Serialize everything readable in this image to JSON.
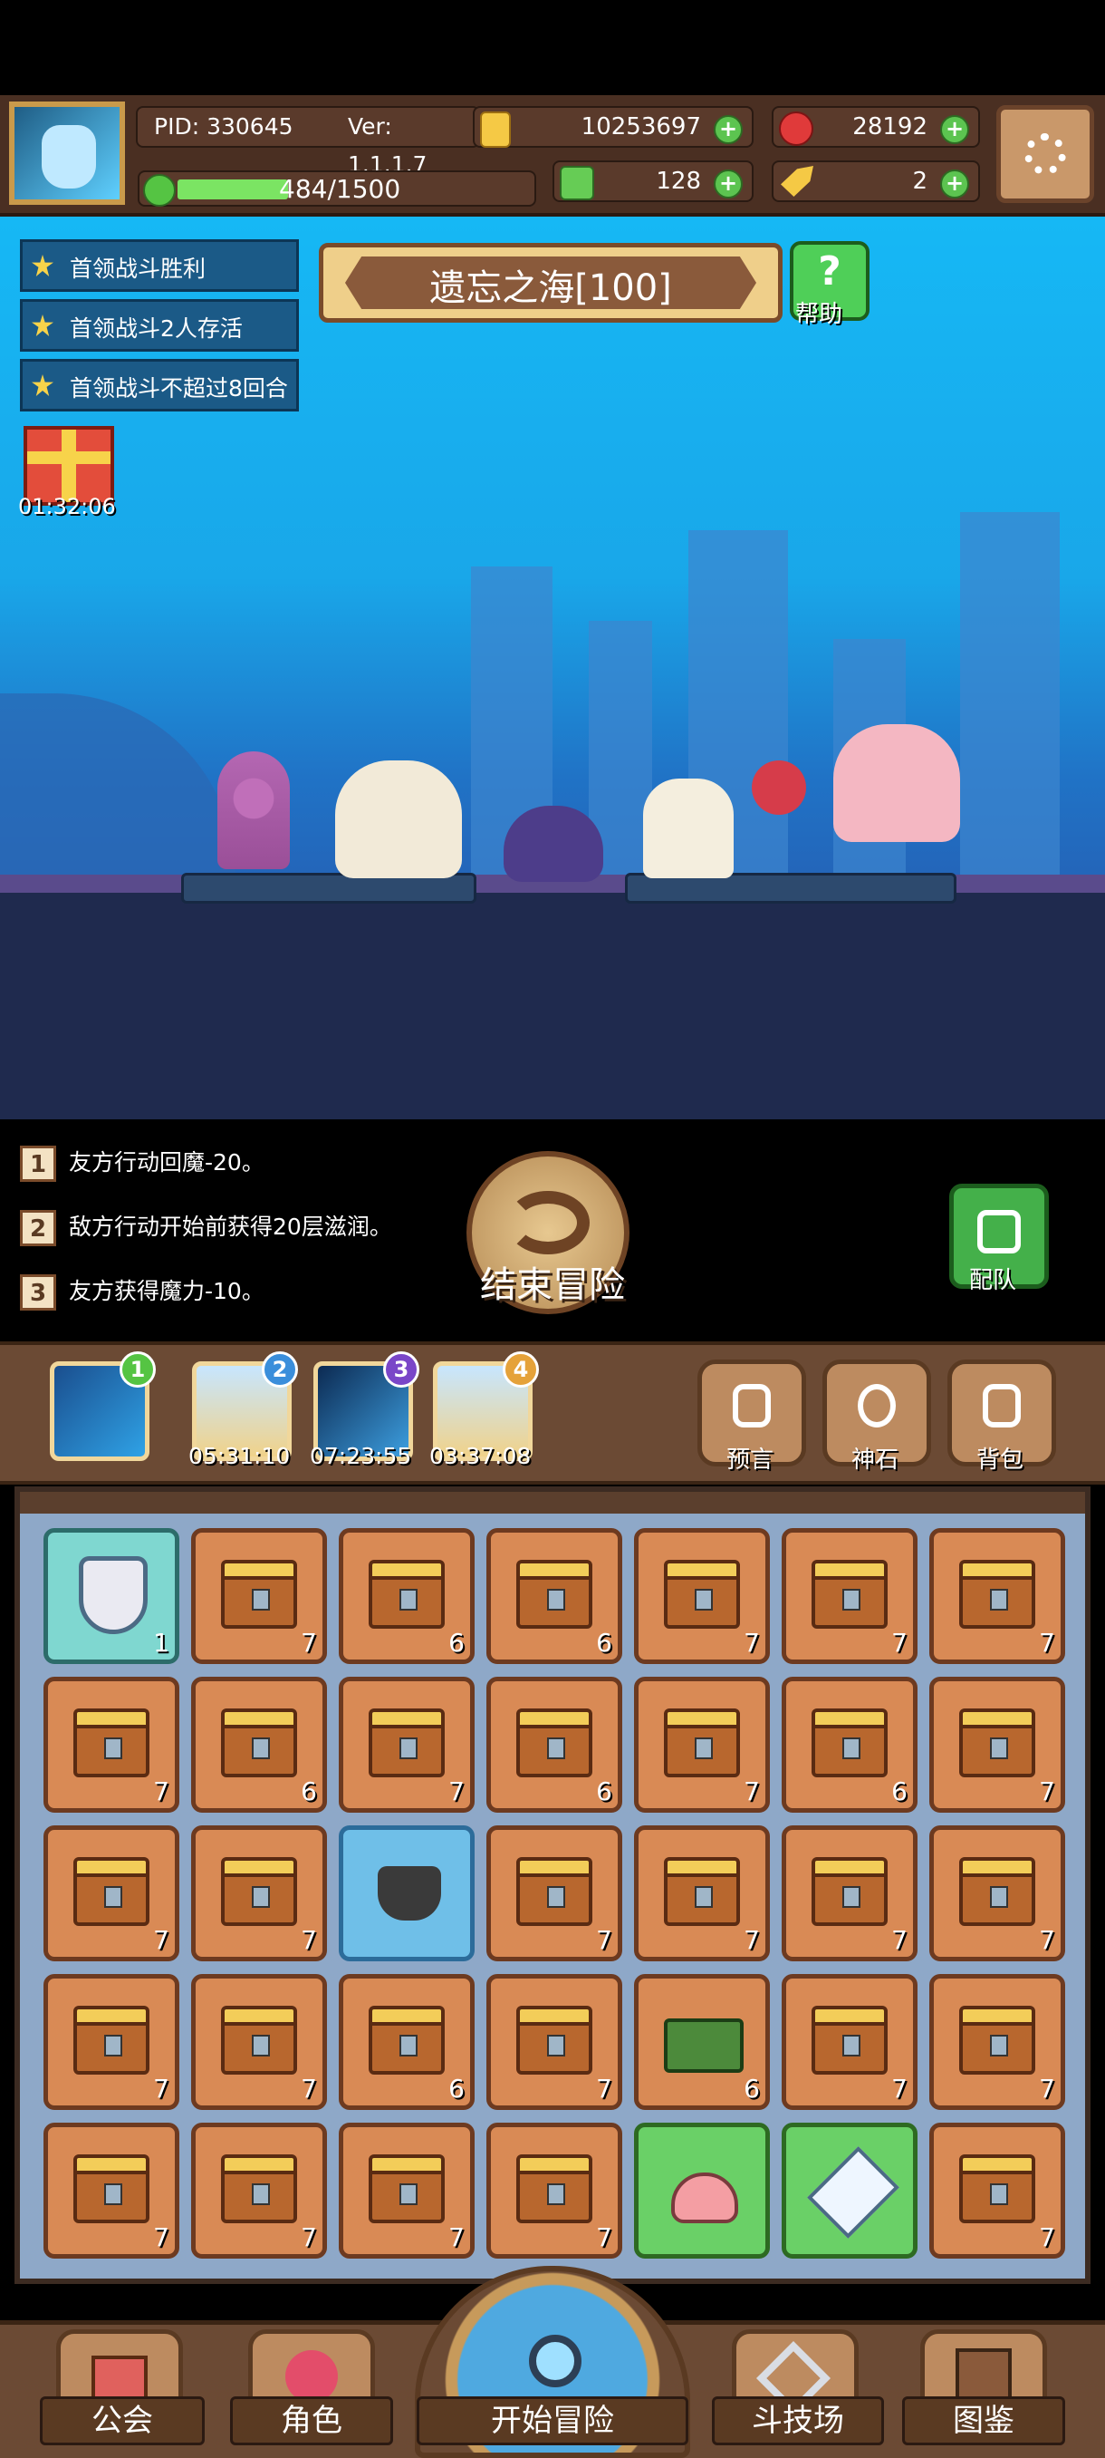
{
  "header": {
    "pid": "PID: 330645",
    "version": "Ver: 1.1.1.7",
    "gold": "10253697",
    "gems": "28192",
    "energy": "484/1500",
    "energy_fraction": 0.32,
    "clovers": "128",
    "keys": "2"
  },
  "quests": [
    {
      "text": "首领战斗胜利"
    },
    {
      "text": "首领战斗2人存活"
    },
    {
      "text": "首领战斗不超过8回合"
    }
  ],
  "gift_timer": "01:32:06",
  "stage": {
    "title": "遗忘之海[100]",
    "help_label": "帮助"
  },
  "log": [
    {
      "num": "1",
      "text": "友方行动回魔-20。"
    },
    {
      "num": "2",
      "text": "敌方行动开始前获得20层滋润。"
    },
    {
      "num": "3",
      "text": "友方获得魔力-10。"
    }
  ],
  "end_label": "结束冒险",
  "team_label": "配队",
  "slots": [
    {
      "badge": "1",
      "timer": ""
    },
    {
      "badge": "2",
      "timer": "05:31:10"
    },
    {
      "badge": "3",
      "timer": "07:23:55"
    },
    {
      "badge": "4",
      "timer": "03:37:08"
    }
  ],
  "toolbar_buttons": [
    {
      "label": "预言",
      "icon": "prophecy-icon"
    },
    {
      "label": "神石",
      "icon": "divine-stone-icon"
    },
    {
      "label": "背包",
      "icon": "backpack-icon"
    }
  ],
  "inventory": [
    [
      {
        "icon": "shield",
        "count": "1"
      },
      {
        "icon": "chest",
        "count": "7"
      },
      {
        "icon": "chest",
        "count": "6"
      },
      {
        "icon": "chest",
        "count": "6"
      },
      {
        "icon": "chest",
        "count": "7"
      },
      {
        "icon": "chest",
        "count": "7"
      },
      {
        "icon": "chest",
        "count": "7"
      }
    ],
    [
      {
        "icon": "chest",
        "count": "7"
      },
      {
        "icon": "chest",
        "count": "6"
      },
      {
        "icon": "chest",
        "count": "7"
      },
      {
        "icon": "chest",
        "count": "6"
      },
      {
        "icon": "chest",
        "count": "7"
      },
      {
        "icon": "chest",
        "count": "6"
      },
      {
        "icon": "chest",
        "count": "7"
      }
    ],
    [
      {
        "icon": "chest",
        "count": "7"
      },
      {
        "icon": "chest",
        "count": "7"
      },
      {
        "icon": "pot",
        "count": ""
      },
      {
        "icon": "chest",
        "count": "7"
      },
      {
        "icon": "chest",
        "count": "7"
      },
      {
        "icon": "chest",
        "count": "7"
      },
      {
        "icon": "chest",
        "count": "7"
      }
    ],
    [
      {
        "icon": "chest",
        "count": "7"
      },
      {
        "icon": "chest",
        "count": "7"
      },
      {
        "icon": "chest",
        "count": "6"
      },
      {
        "icon": "chest",
        "count": "7"
      },
      {
        "icon": "box",
        "count": "6"
      },
      {
        "icon": "chest",
        "count": "7"
      },
      {
        "icon": "chest",
        "count": "7"
      }
    ],
    [
      {
        "icon": "chest",
        "count": "7"
      },
      {
        "icon": "chest",
        "count": "7"
      },
      {
        "icon": "chest",
        "count": "7"
      },
      {
        "icon": "chest",
        "count": "7"
      },
      {
        "icon": "blob",
        "count": ""
      },
      {
        "icon": "crystal",
        "count": ""
      },
      {
        "icon": "chest",
        "count": "7"
      }
    ]
  ],
  "bottom_nav": [
    {
      "label": "公会"
    },
    {
      "label": "角色"
    },
    {
      "label": "开始冒险"
    },
    {
      "label": "斗技场"
    },
    {
      "label": "图鉴"
    }
  ]
}
